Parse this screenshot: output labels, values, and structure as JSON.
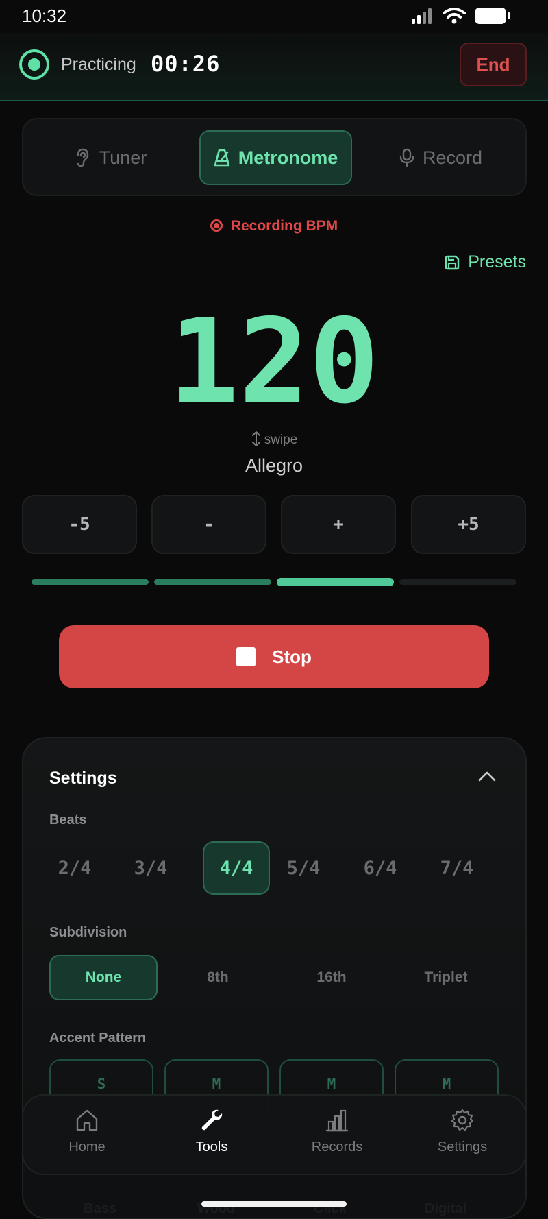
{
  "status_bar": {
    "time": "10:32"
  },
  "header": {
    "status": "Practicing",
    "timer": "00:26",
    "end_label": "End"
  },
  "tabs": [
    {
      "label": "Tuner",
      "icon": "ear-icon",
      "active": false
    },
    {
      "label": "Metronome",
      "icon": "metronome-icon",
      "active": true
    },
    {
      "label": "Record",
      "icon": "microphone-icon",
      "active": false
    }
  ],
  "recording_label": "Recording BPM",
  "presets_label": "Presets",
  "bpm": "120",
  "swipe_hint": "swipe",
  "tempo_name": "Allegro",
  "step_buttons": [
    "-5",
    "-",
    "+",
    "+5"
  ],
  "beat_indicator": {
    "count": 4,
    "current": 3
  },
  "stop_label": "Stop",
  "settings": {
    "title": "Settings",
    "beats_label": "Beats",
    "beats": [
      "2/4",
      "3/4",
      "4/4",
      "5/4",
      "6/4",
      "7/4"
    ],
    "beats_selected": "4/4",
    "subdivision_label": "Subdivision",
    "subdivisions": [
      "None",
      "8th",
      "16th",
      "Triplet"
    ],
    "subdivision_selected": "None",
    "accent_label": "Accent Pattern",
    "accents": [
      "S",
      "M",
      "M",
      "M"
    ]
  },
  "nav": [
    {
      "label": "Home",
      "icon": "home-icon",
      "active": false
    },
    {
      "label": "Tools",
      "icon": "wrench-icon",
      "active": true
    },
    {
      "label": "Records",
      "icon": "bar-chart-icon",
      "active": false
    },
    {
      "label": "Settings",
      "icon": "gear-icon",
      "active": false
    }
  ],
  "ghost_labels": [
    "Bass",
    "Wood",
    "Click",
    "Digital"
  ],
  "colors": {
    "accent": "#6ee3ae",
    "danger": "#d44545",
    "background": "#0a0a0b"
  }
}
